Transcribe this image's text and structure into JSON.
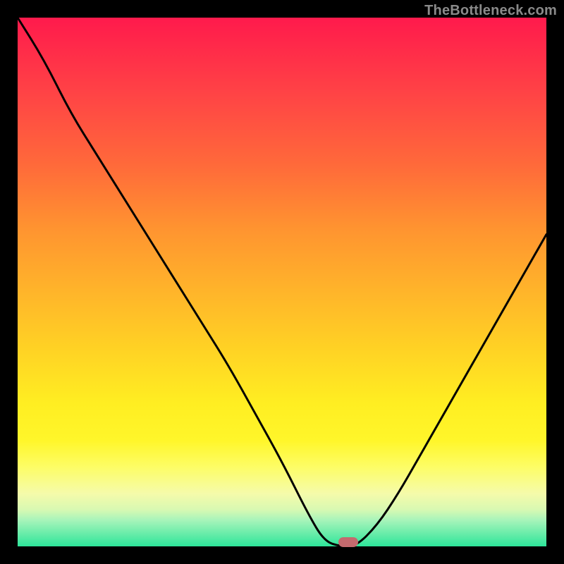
{
  "attribution": "TheBottleneck.com",
  "chart_data": {
    "type": "line",
    "title": "",
    "xlabel": "",
    "ylabel": "",
    "xlim": [
      0,
      100
    ],
    "ylim": [
      0,
      100
    ],
    "grid": false,
    "legend": false,
    "series": [
      {
        "name": "curve",
        "x": [
          0,
          5,
          10,
          15,
          20,
          25,
          30,
          35,
          40,
          45,
          50,
          55,
          58,
          61,
          64,
          68,
          72,
          76,
          80,
          84,
          88,
          92,
          96,
          100
        ],
        "y": [
          100,
          92,
          82,
          74,
          66,
          58,
          50,
          42,
          34,
          25,
          16,
          6,
          1,
          0,
          0,
          4,
          10,
          17,
          24,
          31,
          38,
          45,
          52,
          59
        ]
      }
    ],
    "marker": {
      "x": 62.5,
      "y": 0.8,
      "color": "#c46a6e"
    },
    "gradient_stops": [
      {
        "stop": 0,
        "color": "#ff1a4c"
      },
      {
        "stop": 15,
        "color": "#ff4545"
      },
      {
        "stop": 28,
        "color": "#ff6a3a"
      },
      {
        "stop": 40,
        "color": "#ff9430"
      },
      {
        "stop": 52,
        "color": "#ffb52a"
      },
      {
        "stop": 63,
        "color": "#ffd324"
      },
      {
        "stop": 73,
        "color": "#ffee22"
      },
      {
        "stop": 80,
        "color": "#fff62a"
      },
      {
        "stop": 85,
        "color": "#fdfd66"
      },
      {
        "stop": 90,
        "color": "#f5fbaa"
      },
      {
        "stop": 93,
        "color": "#d9f9b2"
      },
      {
        "stop": 95,
        "color": "#a8f4ba"
      },
      {
        "stop": 100,
        "color": "#2de59a"
      }
    ]
  }
}
